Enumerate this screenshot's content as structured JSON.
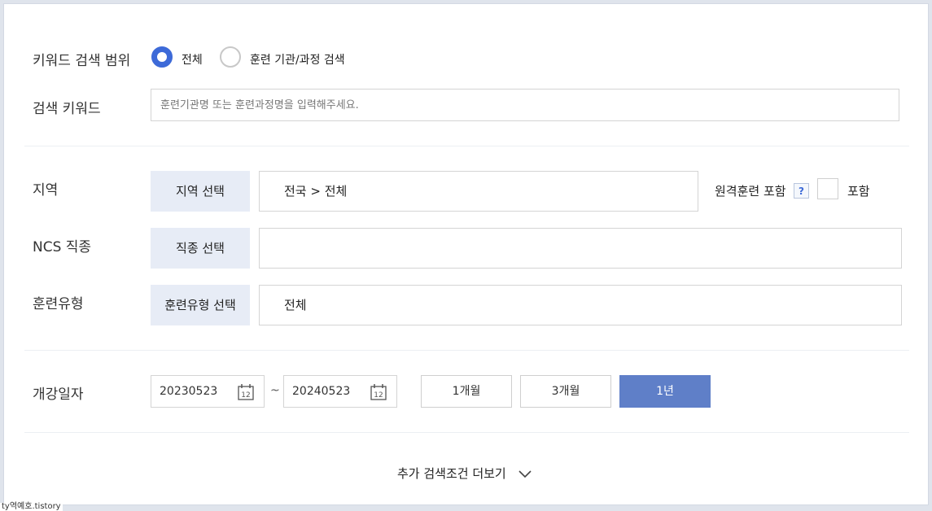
{
  "keyword_scope": {
    "label": "키워드 검색 범위",
    "options": [
      "전체",
      "훈련 기관/과정 검색"
    ],
    "selected": "전체"
  },
  "keyword": {
    "label": "검색 키워드",
    "placeholder": "훈련기관명 또는 훈련과정명을 입력해주세요.",
    "value": ""
  },
  "region": {
    "label": "지역",
    "button": "지역 선택",
    "value": "전국 > 전체",
    "remote_label": "원격훈련 포함",
    "help": "?",
    "include_label": "포함",
    "include_checked": false
  },
  "ncs": {
    "label": "NCS 직종",
    "button": "직종 선택",
    "value": ""
  },
  "training_type": {
    "label": "훈련유형",
    "button": "훈련유형 선택",
    "value": "전체"
  },
  "open_date": {
    "label": "개강일자",
    "start": "20230523",
    "separator": "~",
    "end": "20240523",
    "calendar_icon_text": "12",
    "periods": [
      "1개월",
      "3개월",
      "1년"
    ],
    "selected_period": "1년"
  },
  "more": {
    "label": "추가 검색조건 더보기",
    "icon": "chevron-down-icon"
  },
  "watermark": "ty역예호.tistory",
  "colors": {
    "accent": "#3d6ad8",
    "selected_period_bg": "#5f7fc8",
    "select_button_bg": "#e7ecf6"
  }
}
